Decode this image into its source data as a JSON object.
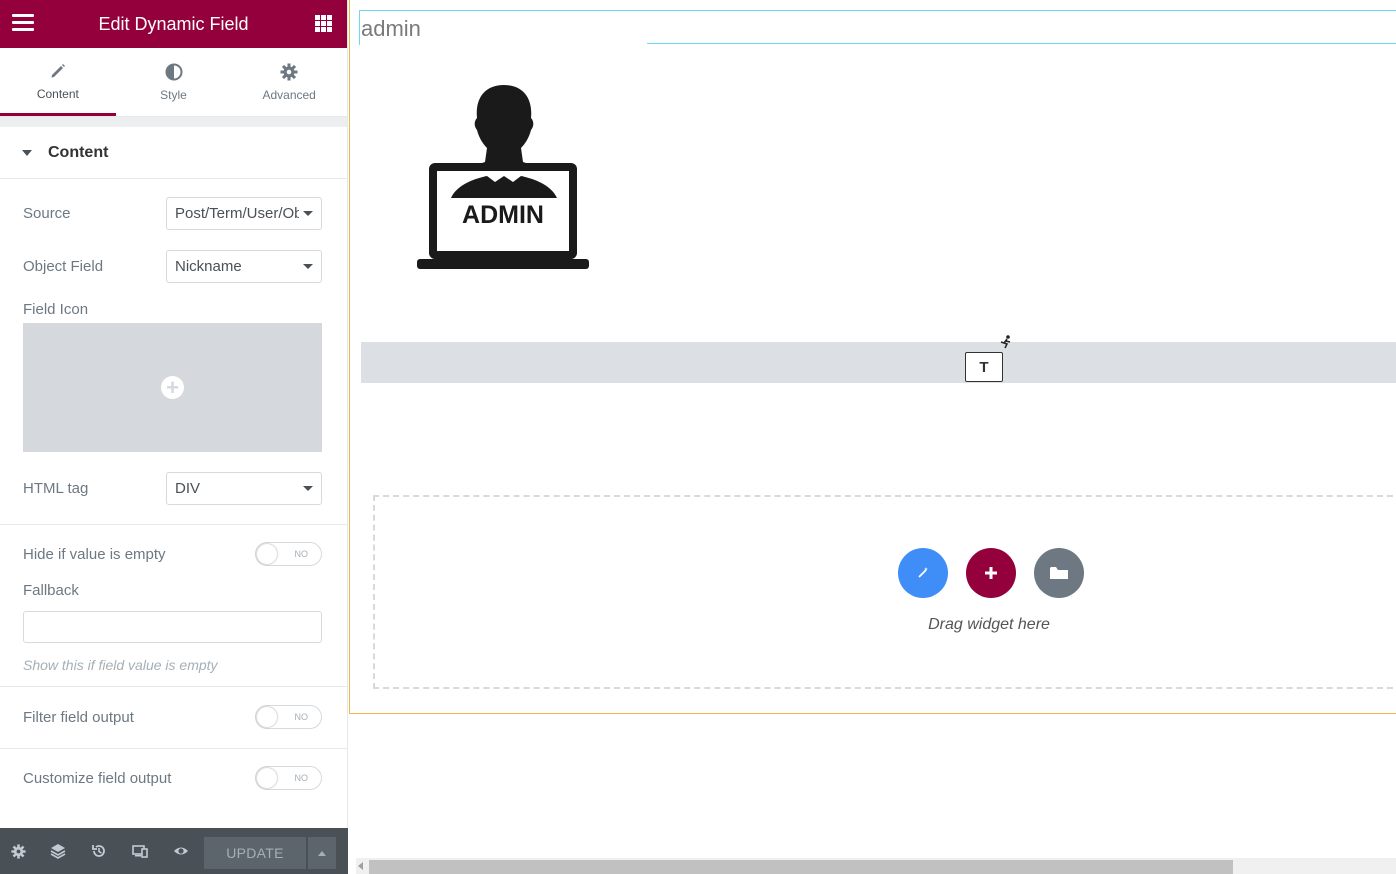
{
  "panel": {
    "title": "Edit Dynamic Field",
    "tabs": [
      {
        "label": "Content",
        "icon": "pencil-icon",
        "active": true
      },
      {
        "label": "Style",
        "icon": "half-circle-icon",
        "active": false
      },
      {
        "label": "Advanced",
        "icon": "gear-icon",
        "active": false
      }
    ],
    "section": "Content",
    "fields": {
      "source": {
        "label": "Source",
        "value": "Post/Term/User/Object Data"
      },
      "object_field": {
        "label": "Object Field",
        "value": "Nickname"
      },
      "field_icon": {
        "label": "Field Icon"
      },
      "html_tag": {
        "label": "HTML tag",
        "value": "DIV"
      },
      "hide_if_empty": {
        "label": "Hide if value is empty",
        "state": "NO"
      },
      "fallback": {
        "label": "Fallback",
        "value": "",
        "hint": "Show this if field value is empty"
      },
      "filter_output": {
        "label": "Filter field output",
        "state": "NO"
      },
      "customize_output": {
        "label": "Customize field output",
        "state": "NO"
      }
    },
    "footer": {
      "update_label": "UPDATE",
      "icons": [
        "settings-icon",
        "layers-icon",
        "history-icon",
        "responsive-icon",
        "preview-eye-icon"
      ]
    }
  },
  "canvas": {
    "field_value": "admin",
    "image_text": "ADMIN",
    "widget_badge": "T",
    "drag_hint": "Drag widget here"
  },
  "colors": {
    "brand": "#93003c",
    "accent_blue": "#3f8ef8",
    "folder_gray": "#6d7882",
    "edit_outline": "#f0b849",
    "field_outline": "#71d7f7"
  }
}
